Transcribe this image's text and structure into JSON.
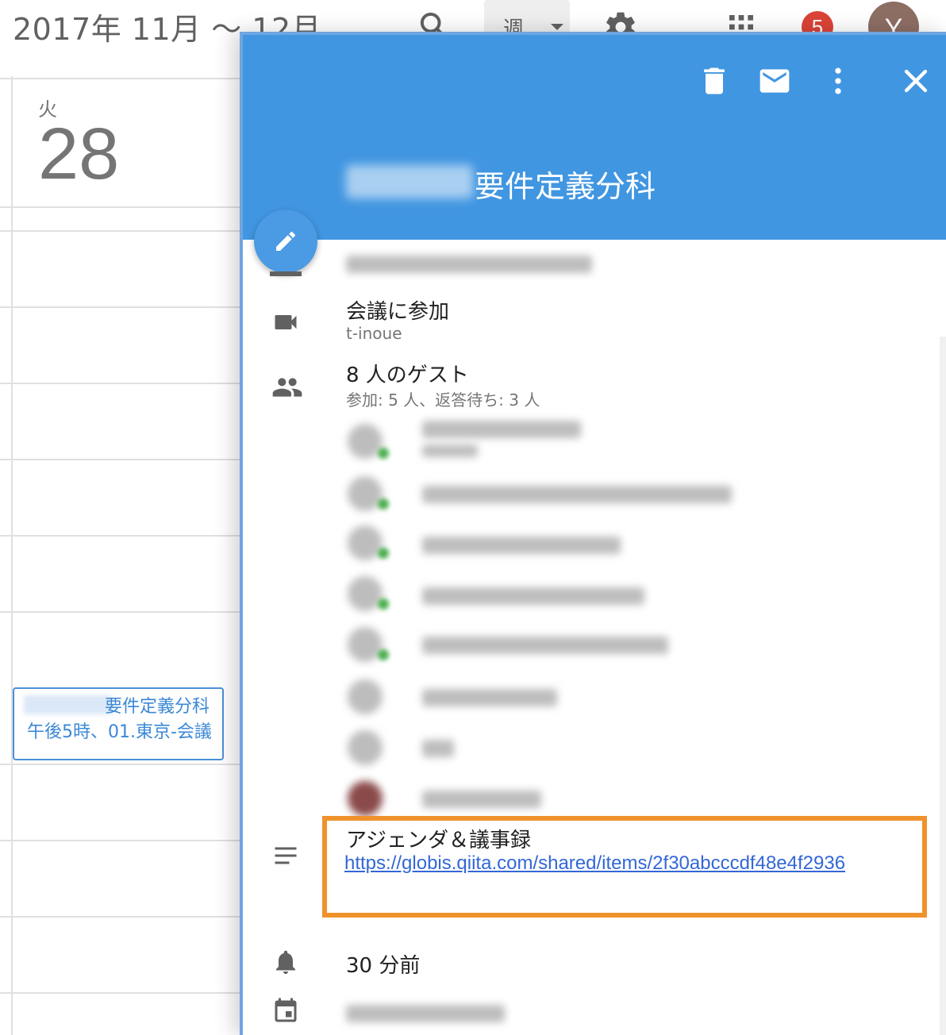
{
  "header": {
    "date_range": "2017年 11月 〜 12月",
    "view_label": "週",
    "notification_count": "5",
    "avatar_letter": "Y"
  },
  "calendar": {
    "day_name": "火",
    "day_number": "28",
    "event_chip": {
      "title": "要件定義分科",
      "subtitle": "午後5時、01.東京-会議"
    }
  },
  "event": {
    "title": "要件定義分科",
    "meeting": {
      "label": "会議に参加",
      "sub": "t-inoue"
    },
    "guests": {
      "label": "8 人のゲスト",
      "summary": "参加: 5 人、返答待ち: 3 人"
    },
    "agenda": {
      "title": "アジェンダ＆議事録",
      "link": "https://globis.qiita.com/shared/items/2f30abcccdf48e4f2936"
    },
    "reminder": "30 分前"
  },
  "icons": {
    "search": "search-icon",
    "settings": "gear-icon",
    "apps": "apps-grid-icon",
    "delete": "trash-icon",
    "email": "mail-icon",
    "more": "more-vert-icon",
    "close": "close-icon",
    "edit": "pencil-icon",
    "video": "video-icon",
    "guests": "people-icon",
    "description": "notes-icon",
    "reminder": "bell-icon",
    "calendar": "calendar-icon"
  },
  "colors": {
    "header_blue": "#4196e1",
    "highlight_orange": "#f0922b",
    "link_blue": "#3367d6",
    "badge_red": "#db4437"
  }
}
